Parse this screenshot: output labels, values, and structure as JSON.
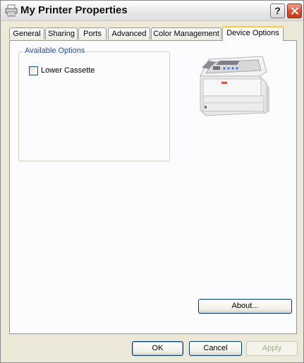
{
  "window": {
    "title": "My Printer Properties",
    "help_label": "?"
  },
  "tabs": [
    {
      "label": "General",
      "active": false
    },
    {
      "label": "Sharing",
      "active": false
    },
    {
      "label": "Ports",
      "active": false
    },
    {
      "label": "Advanced",
      "active": false
    },
    {
      "label": "Color Management",
      "active": false
    },
    {
      "label": "Device Options",
      "active": true
    }
  ],
  "device_options": {
    "group_label": "Available Options",
    "options": [
      {
        "label": "Lower Cassette",
        "checked": false
      }
    ],
    "about_label": "About..."
  },
  "footer": {
    "ok_label": "OK",
    "cancel_label": "Cancel",
    "apply_label": "Apply",
    "apply_enabled": false
  },
  "icons": {
    "title_icon": "printer-icon",
    "help": "help-icon",
    "close": "close-icon"
  },
  "colors": {
    "active_tab_accent": "#ffc83c",
    "group_label": "#1f4fa8",
    "close_button": "#d8502f"
  }
}
